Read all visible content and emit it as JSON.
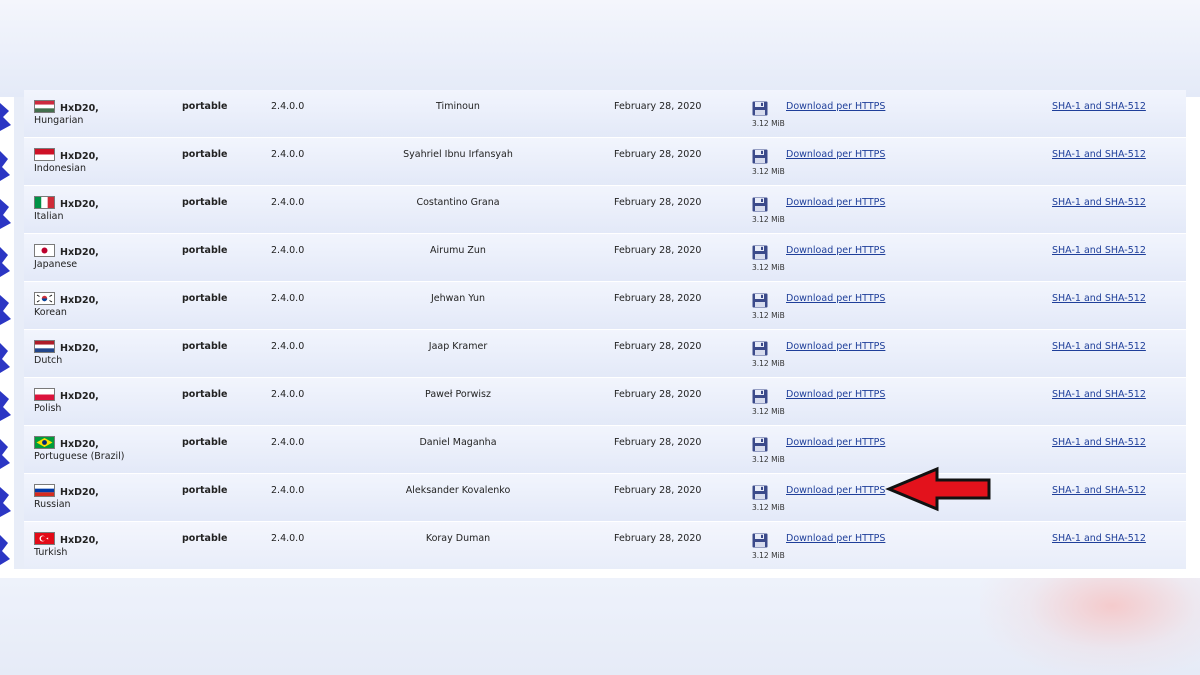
{
  "product": "HxD20,",
  "rows": [
    {
      "language": "Hungarian",
      "flag_name": "hungary-flag-icon",
      "edition": "portable",
      "version": "2.4.0.0",
      "translator": "Timinoun",
      "date": "February 28, 2020",
      "size": "3.12 MiB",
      "download": "Download per HTTPS",
      "checksums": "SHA-1 and SHA-512"
    },
    {
      "language": "Indonesian",
      "flag_name": "indonesia-flag-icon",
      "edition": "portable",
      "version": "2.4.0.0",
      "translator": "Syahriel Ibnu Irfansyah",
      "date": "February 28, 2020",
      "size": "3.12 MiB",
      "download": "Download per HTTPS",
      "checksums": "SHA-1 and SHA-512"
    },
    {
      "language": "Italian",
      "flag_name": "italy-flag-icon",
      "edition": "portable",
      "version": "2.4.0.0",
      "translator": "Costantino Grana",
      "date": "February 28, 2020",
      "size": "3.12 MiB",
      "download": "Download per HTTPS",
      "checksums": "SHA-1 and SHA-512"
    },
    {
      "language": "Japanese",
      "flag_name": "japan-flag-icon",
      "edition": "portable",
      "version": "2.4.0.0",
      "translator": "Airumu Zun",
      "date": "February 28, 2020",
      "size": "3.12 MiB",
      "download": "Download per HTTPS",
      "checksums": "SHA-1 and SHA-512"
    },
    {
      "language": "Korean",
      "flag_name": "south-korea-flag-icon",
      "edition": "portable",
      "version": "2.4.0.0",
      "translator": "Jehwan Yun",
      "date": "February 28, 2020",
      "size": "3.12 MiB",
      "download": "Download per HTTPS",
      "checksums": "SHA-1 and SHA-512"
    },
    {
      "language": "Dutch",
      "flag_name": "netherlands-flag-icon",
      "edition": "portable",
      "version": "2.4.0.0",
      "translator": "Jaap Kramer",
      "date": "February 28, 2020",
      "size": "3.12 MiB",
      "download": "Download per HTTPS",
      "checksums": "SHA-1 and SHA-512"
    },
    {
      "language": "Polish",
      "flag_name": "poland-flag-icon",
      "edition": "portable",
      "version": "2.4.0.0",
      "translator": "Paweł Porwisz",
      "date": "February 28, 2020",
      "size": "3.12 MiB",
      "download": "Download per HTTPS",
      "checksums": "SHA-1 and SHA-512"
    },
    {
      "language": "Portuguese (Brazil)",
      "flag_name": "brazil-flag-icon",
      "edition": "portable",
      "version": "2.4.0.0",
      "translator": "Daniel Maganha",
      "date": "February 28, 2020",
      "size": "3.12 MiB",
      "download": "Download per HTTPS",
      "checksums": "SHA-1 and SHA-512"
    },
    {
      "language": "Russian",
      "flag_name": "russia-flag-icon",
      "edition": "portable",
      "version": "2.4.0.0",
      "translator": "Aleksander Kovalenko",
      "date": "February 28, 2020",
      "size": "3.12 MiB",
      "download": "Download per HTTPS",
      "checksums": "SHA-1 and SHA-512"
    },
    {
      "language": "Turkish",
      "flag_name": "turkey-flag-icon",
      "edition": "portable",
      "version": "2.4.0.0",
      "translator": "Koray Duman",
      "date": "February 28, 2020",
      "size": "3.12 MiB",
      "download": "Download per HTTPS",
      "checksums": "SHA-1 and SHA-512"
    }
  ],
  "highlight": {
    "row_language": "Russian",
    "color": "#e3121c"
  },
  "colors": {
    "link": "#1f3f9a",
    "row_bg_top": "#f2f5fd",
    "row_bg_bottom": "#e3e9f8",
    "disk_icon": "#3b4a8a"
  }
}
